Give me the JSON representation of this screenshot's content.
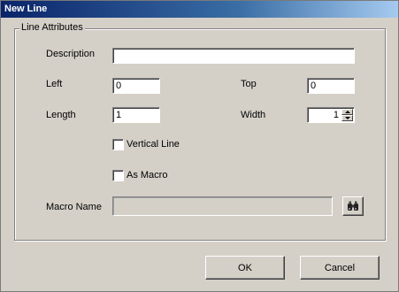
{
  "window": {
    "title": "New Line"
  },
  "group": {
    "label": "Line Attributes"
  },
  "fields": {
    "description": {
      "label": "Description",
      "value": ""
    },
    "left": {
      "label": "Left",
      "value": "0"
    },
    "top": {
      "label": "Top",
      "value": "0"
    },
    "length": {
      "label": "Length",
      "value": "1"
    },
    "width": {
      "label": "Width",
      "value": "1"
    },
    "vertical_line": {
      "label": "Vertical Line",
      "checked": false
    },
    "as_macro": {
      "label": "As Macro",
      "checked": false
    },
    "macro_name": {
      "label": "Macro Name",
      "value": "",
      "disabled": true
    }
  },
  "icons": {
    "browse": "binoculars-icon"
  },
  "buttons": {
    "ok": "OK",
    "cancel": "Cancel"
  }
}
